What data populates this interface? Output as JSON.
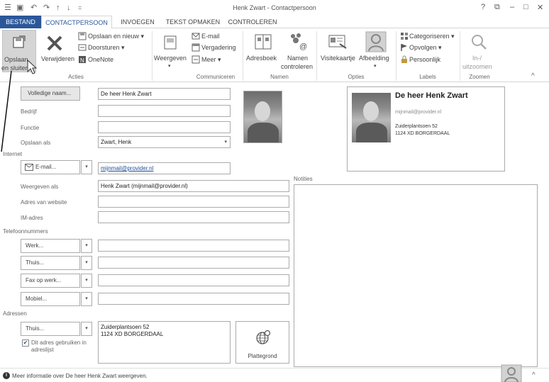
{
  "window": {
    "title": "Henk Zwart - Contactpersoon",
    "help": "?",
    "restore": "⧉",
    "minimize": "–",
    "maximize": "□",
    "close": "✕"
  },
  "quick_access": [
    "☰",
    "▣",
    "↶",
    "↷",
    "↑",
    "↓",
    "="
  ],
  "tabs": [
    "BESTAND",
    "CONTACTPERSOON",
    "INVOEGEN",
    "TEKST OPMAKEN",
    "CONTROLEREN"
  ],
  "ribbon": {
    "save_close_1": "Opslaan",
    "save_close_2": "en sluiten",
    "delete": "Verwijderen",
    "save_new": "Opslaan en nieuw ▾",
    "forward": "Doorsturen ▾",
    "onenote": "OneNote",
    "group_acties": "Acties",
    "views": "Weergeven",
    "views_arrow": "▾",
    "email": "E-mail",
    "meeting": "Vergadering",
    "more": "Meer ▾",
    "group_communiceren": "Communiceren",
    "addressbook": "Adresboek",
    "check_names_1": "Namen",
    "check_names_2": "controleren",
    "group_namen": "Namen",
    "business_card": "Visitekaartje",
    "picture": "Afbeelding",
    "picture_arrow": "▾",
    "group_opties": "Opties",
    "categorize": "Categoriseren ▾",
    "followup": "Opvolgen ▾",
    "private": "Persoonlijk",
    "group_labels": "Labels",
    "zoom_1": "In-/",
    "zoom_2": "uitzoomen",
    "group_zoomen": "Zoomen",
    "collapse": "^"
  },
  "form": {
    "fullname_button": "Volledige naam...",
    "fullname_value": "De heer Henk Zwart",
    "company_label": "Bedrijf",
    "company_value": "",
    "jobtitle_label": "Functie",
    "jobtitle_value": "",
    "fileas_label": "Opslaan als",
    "fileas_value": "Zwart, Henk",
    "internet_section": "Internet",
    "email_button": "E-mail...",
    "email_value": "mijnmail@provider.nl",
    "display_label": "Weergeven als",
    "display_value": "Henk Zwart (mijnmail@provider.nl)",
    "web_label": "Adres van website",
    "web_value": "",
    "im_label": "IM-adres",
    "im_value": "",
    "phone_section": "Telefoonnummers",
    "phones": [
      {
        "label": "Werk...",
        "value": ""
      },
      {
        "label": "Thuis...",
        "value": ""
      },
      {
        "label": "Fax op werk...",
        "value": ""
      },
      {
        "label": "Mobiel...",
        "value": ""
      }
    ],
    "address_section": "Adressen",
    "address_type": "Thuis...",
    "address_line1": "Zuiderplantsoen 52",
    "address_line2": "1124 XD BORGERDAAL",
    "mailing_check": "✔",
    "mailing_label_1": "Dit adres gebruiken in",
    "mailing_label_2": "adreslijst",
    "map_label": "Plattegrond",
    "notes_label": "Notities",
    "dd_arrow": "▾"
  },
  "card": {
    "name": "De heer Henk Zwart",
    "email": "mijnmail@provider.nl",
    "street": "Zuiderplantsoen 52",
    "city": "1124 XD BORGERDAAL"
  },
  "statusbar": {
    "info_icon": "i",
    "text": "Meer informatie over De heer Henk Zwart weergeven.",
    "collapse": "^"
  },
  "colors": {
    "accent": "#2b579a",
    "link": "#1f4e99"
  }
}
